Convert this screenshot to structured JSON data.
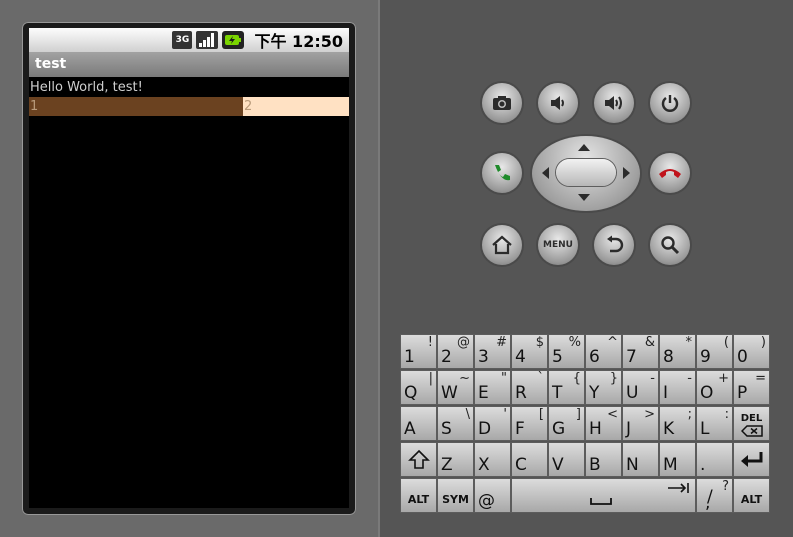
{
  "status_bar": {
    "network_icon": "3G",
    "signal_icon": "signal-bars-icon",
    "battery_icon": "battery-charging-icon",
    "time": "下午 12:50"
  },
  "app": {
    "title": "test",
    "hello_text": "Hello World, test!",
    "row_cells": [
      "1",
      "2"
    ]
  },
  "controls": {
    "top_row": [
      "camera-icon",
      "volume-down-icon",
      "volume-up-icon",
      "power-icon"
    ],
    "call_icon": "call-icon",
    "end_call_icon": "end-call-icon",
    "menu_label": "MENU",
    "bottom_row": [
      "home-icon",
      "back-icon",
      "search-icon"
    ]
  },
  "keyboard": {
    "row1": [
      {
        "main": "1",
        "alt": "!"
      },
      {
        "main": "2",
        "alt": "@"
      },
      {
        "main": "3",
        "alt": "#"
      },
      {
        "main": "4",
        "alt": "$"
      },
      {
        "main": "5",
        "alt": "%"
      },
      {
        "main": "6",
        "alt": "^"
      },
      {
        "main": "7",
        "alt": "&"
      },
      {
        "main": "8",
        "alt": "*"
      },
      {
        "main": "9",
        "alt": "("
      },
      {
        "main": "0",
        "alt": ")"
      }
    ],
    "row2": [
      {
        "main": "Q",
        "alt": "|"
      },
      {
        "main": "W",
        "alt": "~"
      },
      {
        "main": "E",
        "alt": "\""
      },
      {
        "main": "R",
        "alt": "`"
      },
      {
        "main": "T",
        "alt": "{"
      },
      {
        "main": "Y",
        "alt": "}"
      },
      {
        "main": "U",
        "alt": "-"
      },
      {
        "main": "I",
        "alt": "-"
      },
      {
        "main": "O",
        "alt": "+"
      },
      {
        "main": "P",
        "alt": "="
      }
    ],
    "row3": [
      {
        "main": "A",
        "alt": ""
      },
      {
        "main": "S",
        "alt": "\\"
      },
      {
        "main": "D",
        "alt": "'"
      },
      {
        "main": "F",
        "alt": "["
      },
      {
        "main": "G",
        "alt": "]"
      },
      {
        "main": "H",
        "alt": "<"
      },
      {
        "main": "J",
        "alt": ">"
      },
      {
        "main": "K",
        "alt": ";"
      },
      {
        "main": "L",
        "alt": ":"
      }
    ],
    "del_label": "DEL",
    "row4": [
      {
        "main": "Z",
        "alt": ""
      },
      {
        "main": "X",
        "alt": ""
      },
      {
        "main": "C",
        "alt": ""
      },
      {
        "main": "V",
        "alt": ""
      },
      {
        "main": "B",
        "alt": ""
      },
      {
        "main": "N",
        "alt": ""
      },
      {
        "main": "M",
        "alt": ""
      },
      {
        "main": ".",
        "alt": ""
      }
    ],
    "alt_label": "ALT",
    "sym_label": "SYM",
    "at_label": "@",
    "slash_key": {
      "main": "/",
      "alt": "?"
    },
    "comma_alt": ","
  }
}
